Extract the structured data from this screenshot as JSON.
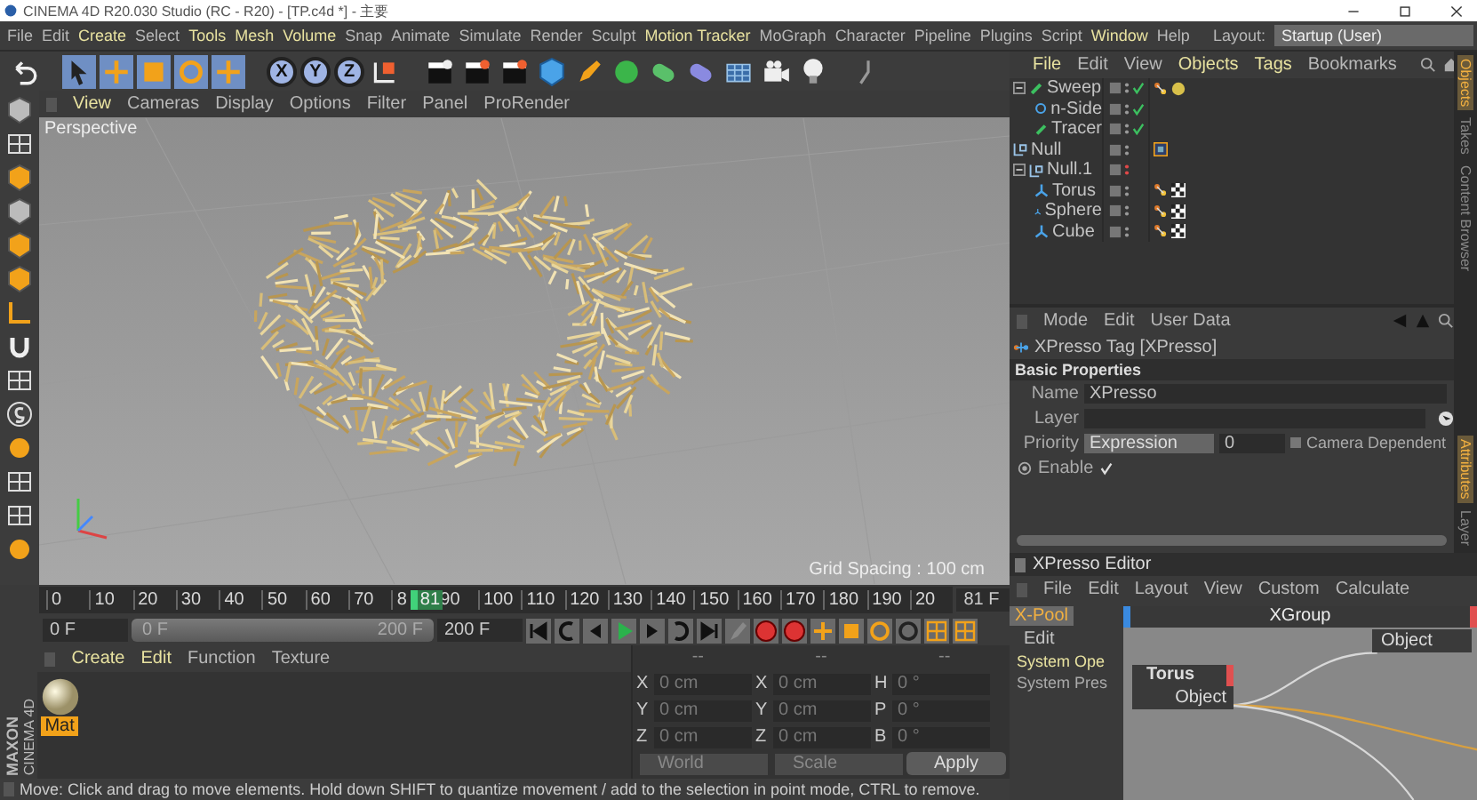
{
  "window": {
    "title": "CINEMA 4D R20.030 Studio (RC - R20) - [TP.c4d *] - 主要"
  },
  "menu_bar": [
    {
      "label": "File",
      "highlight": false
    },
    {
      "label": "Edit",
      "highlight": false
    },
    {
      "label": "Create",
      "highlight": true
    },
    {
      "label": "Select",
      "highlight": false
    },
    {
      "label": "Tools",
      "highlight": true
    },
    {
      "label": "Mesh",
      "highlight": true
    },
    {
      "label": "Volume",
      "highlight": true
    },
    {
      "label": "Snap",
      "highlight": false
    },
    {
      "label": "Animate",
      "highlight": false
    },
    {
      "label": "Simulate",
      "highlight": false
    },
    {
      "label": "Render",
      "highlight": false
    },
    {
      "label": "Sculpt",
      "highlight": false
    },
    {
      "label": "Motion Tracker",
      "highlight": true
    },
    {
      "label": "MoGraph",
      "highlight": false
    },
    {
      "label": "Character",
      "highlight": false
    },
    {
      "label": "Pipeline",
      "highlight": false
    },
    {
      "label": "Plugins",
      "highlight": false
    },
    {
      "label": "Script",
      "highlight": false
    },
    {
      "label": "Window",
      "highlight": true
    },
    {
      "label": "Help",
      "highlight": false
    }
  ],
  "layout": {
    "label": "Layout:",
    "value": "Startup (User)"
  },
  "toolbar": {
    "axes": [
      {
        "label": "X",
        "on": true
      },
      {
        "label": "Y",
        "on": true
      },
      {
        "label": "Z",
        "on": true
      }
    ]
  },
  "viewport": {
    "menu": [
      {
        "label": "View",
        "highlight": true
      },
      {
        "label": "Cameras",
        "highlight": false
      },
      {
        "label": "Display",
        "highlight": false
      },
      {
        "label": "Options",
        "highlight": false
      },
      {
        "label": "Filter",
        "highlight": false
      },
      {
        "label": "Panel",
        "highlight": false
      },
      {
        "label": "ProRender",
        "highlight": false
      }
    ],
    "camera": "Perspective",
    "grid_spacing": "Grid Spacing : 100 cm"
  },
  "timeline": {
    "ticks": [
      "0",
      "10",
      "20",
      "30",
      "40",
      "50",
      "60",
      "70",
      "8",
      "90",
      "100",
      "110",
      "120",
      "130",
      "140",
      "150",
      "160",
      "170",
      "180",
      "190",
      "20"
    ],
    "current": "81",
    "current_field": "81 F"
  },
  "transport": {
    "start": "0 F",
    "range_start": "0 F",
    "range_end": "200 F",
    "end": "200 F"
  },
  "materials": {
    "menu": [
      {
        "label": "Create",
        "highlight": true
      },
      {
        "label": "Edit",
        "highlight": true
      },
      {
        "label": "Function",
        "highlight": false
      },
      {
        "label": "Texture",
        "highlight": false
      }
    ],
    "items": [
      {
        "name": "Mat",
        "selected": true
      }
    ]
  },
  "coordinates": {
    "headers": [
      "--",
      "--",
      "--"
    ],
    "rows": [
      {
        "axis": "X",
        "position": "0 cm",
        "size_axis": "X",
        "size": "0 cm",
        "rot_axis": "H",
        "rotation": "0 °"
      },
      {
        "axis": "Y",
        "position": "0 cm",
        "size_axis": "Y",
        "size": "0 cm",
        "rot_axis": "P",
        "rotation": "0 °"
      },
      {
        "axis": "Z",
        "position": "0 cm",
        "size_axis": "Z",
        "size": "0 cm",
        "rot_axis": "B",
        "rotation": "0 °"
      }
    ],
    "mode": "World",
    "transform": "Scale",
    "apply": "Apply"
  },
  "logo": {
    "brand": "MAXON",
    "product": "CINEMA 4D"
  },
  "status_bar": "Move: Click and drag to move elements. Hold down SHIFT to quantize movement / add to the selection in point mode, CTRL to remove.",
  "objects_panel": {
    "menu": [
      {
        "label": "File",
        "highlight": true
      },
      {
        "label": "Edit",
        "highlight": false
      },
      {
        "label": "View",
        "highlight": false
      },
      {
        "label": "Objects",
        "highlight": true
      },
      {
        "label": "Tags",
        "highlight": true
      },
      {
        "label": "Bookmarks",
        "highlight": false
      }
    ],
    "tree": [
      {
        "name": "Sweep",
        "kind": "sweep",
        "expanded": true,
        "check": true,
        "hidden": false,
        "tags": [
          {
            "kind": "xpresso"
          },
          {
            "kind": "material"
          }
        ],
        "children": [
          {
            "name": "n-Side",
            "kind": "spline",
            "check": true,
            "hidden": false
          },
          {
            "name": "Tracer",
            "kind": "tracer",
            "check": true,
            "hidden": false
          }
        ]
      },
      {
        "name": "Null",
        "kind": "null",
        "check": false,
        "hidden": false,
        "tags": [
          {
            "kind": "selection"
          }
        ]
      },
      {
        "name": "Null.1",
        "kind": "null",
        "expanded": true,
        "check": false,
        "hidden": true,
        "children": [
          {
            "name": "Torus",
            "kind": "primitive",
            "check": false,
            "hidden": false,
            "tags": [
              {
                "kind": "xpresso"
              },
              {
                "kind": "checker"
              }
            ]
          },
          {
            "name": "Sphere",
            "kind": "primitive",
            "check": false,
            "hidden": false,
            "tags": [
              {
                "kind": "xpresso"
              },
              {
                "kind": "checker"
              }
            ]
          },
          {
            "name": "Cube",
            "kind": "primitive",
            "check": false,
            "hidden": false,
            "tags": [
              {
                "kind": "xpresso"
              },
              {
                "kind": "checker"
              }
            ]
          }
        ]
      }
    ]
  },
  "side_tabs_top": [
    {
      "label": "Objects",
      "selected": true
    },
    {
      "label": "Takes",
      "selected": false
    },
    {
      "label": "Content Browser",
      "selected": false
    }
  ],
  "side_tabs_bottom": [
    {
      "label": "Attributes",
      "selected": true
    },
    {
      "label": "Layer",
      "selected": false
    }
  ],
  "attributes_panel": {
    "menu": [
      "Mode",
      "Edit",
      "User Data"
    ],
    "title": "XPresso Tag [XPresso]",
    "section": "Basic Properties",
    "name_label": "Name",
    "name_value": "XPresso",
    "layer_label": "Layer",
    "priority_label": "Priority",
    "priority_value": "Expression",
    "priority_number": "0",
    "camera_dependent": {
      "label": "Camera Dependent",
      "checked": false
    },
    "enable": {
      "label": "Enable",
      "checked": true
    }
  },
  "xpresso_editor": {
    "title": "XPresso Editor",
    "menu": [
      "File",
      "Edit",
      "Layout",
      "View",
      "Custom",
      "Calculate"
    ],
    "pool_tab": "X-Pool",
    "pool_menu": "Edit",
    "pool_items": [
      {
        "label": "System Ope",
        "selected": true
      },
      {
        "label": "System Pres",
        "selected": false
      }
    ],
    "group": "XGroup",
    "nodes": [
      {
        "title": "Torus",
        "port": "Object",
        "kind": "source"
      },
      {
        "port": "Object",
        "kind": "target"
      }
    ]
  }
}
